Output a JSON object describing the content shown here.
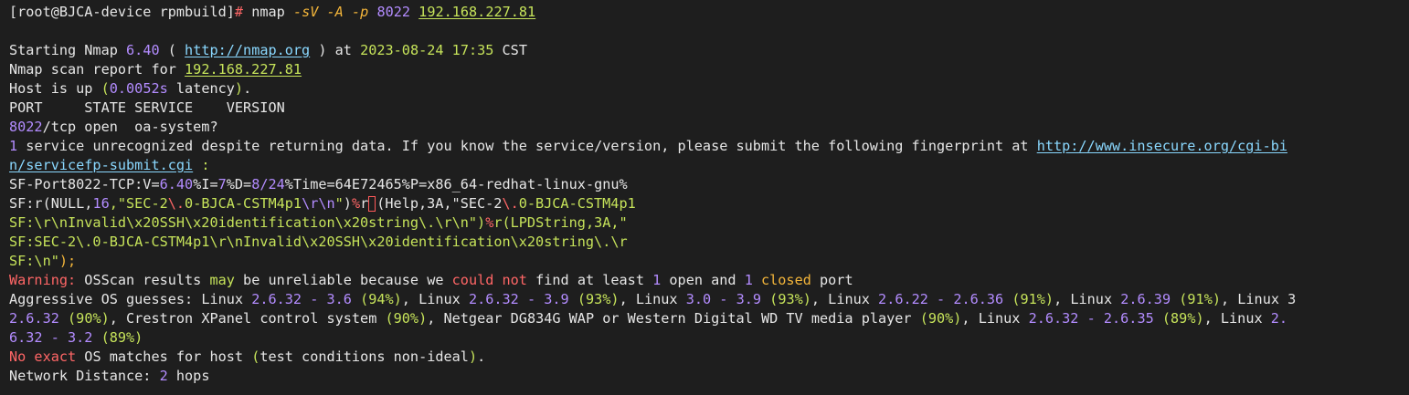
{
  "top_fragment": "        '",
  "prompt": {
    "user_host_dir": "[root@BJCA-device rpmbuild]",
    "hash": "#",
    "command": "nmap",
    "arg1": "-sV",
    "arg2": "-A",
    "arg3": "-p",
    "port": "8022",
    "target": "192.168.227.81"
  },
  "starting": {
    "prefix": "Starting Nmap",
    "version": "6.40",
    "open_paren": " ( ",
    "url": "http://nmap.org",
    "close_paren": " ) at ",
    "date": "2023-08-24",
    "time": "17:35",
    "tz": " CST"
  },
  "scan_report": {
    "prefix": "Nmap scan report for ",
    "ip": "192.168.227.81"
  },
  "host_up": {
    "prefix": "Host is up ",
    "latency": "(0.0052s latency).",
    "rest": ""
  },
  "table_header": "PORT     STATE SERVICE    VERSION",
  "port_line": {
    "port": "8022",
    "rest": "/tcp open  oa-system?"
  },
  "service_unrec": {
    "count": "1",
    "text": " service unrecognized despite returning data. If you know the service/version, please submit the following fingerprint at ",
    "url1": "http://www.insecure.org/cgi-bi",
    "url2": "n/servicefp-submit.cgi",
    "tail": " :"
  },
  "fingerprint": {
    "line1_a": "SF-Port8022-TCP:V=",
    "line1_b": "6.40",
    "line1_c": "%I=",
    "line1_d": "7",
    "line1_e": "%D=",
    "line1_f": "8/24",
    "line1_g": "%Time=64E72465%P=x86_64-redhat-linux-gnu%",
    "line2_a": "SF:r(NULL,",
    "line2_b": "16",
    "line2_c": ",\"SEC-2",
    "line2_d": "\\.",
    "line2_e": "0-BJCA-CSTM4p1",
    "line2_f": "\\r\\n",
    "line2_g": "\")",
    "line2_h": "%",
    "line2_i": "r",
    "line2_j": "(Help,3A,\"SEC-2",
    "line2_k": "\\.",
    "line2_l": "0-BJCA-CSTM4p1",
    "line3_a": "SF:\\r\\nInvalid\\x20SSH\\x20identification\\x20string\\.\\r\\n\")",
    "line3_b": "%",
    "line3_c": "r(LPDString,3A,\"",
    "line4": "SF:SEC-2\\.0-BJCA-CSTM4p1\\r\\nInvalid\\x20SSH\\x20identification\\x20string\\.\\r",
    "line5_a": "SF:\\n\"",
    "line5_b": ");"
  },
  "warning": {
    "w1": "Warning:",
    "w2": " OSScan results ",
    "w3": "may",
    "w4": " be unreliable because we ",
    "w5": "could not",
    "w6": " find at least ",
    "w7": "1",
    "w8": " open and ",
    "w9": "1",
    "w10": " closed",
    "w11": " port"
  },
  "guesses": {
    "label": "Aggressive OS guesses: ",
    "line1": [
      {
        "t": "Linux ",
        "c": "w"
      },
      {
        "t": "2.6.32 - 3.6",
        "c": "p"
      },
      {
        "t": " ",
        "c": "w"
      },
      {
        "t": "(94%)",
        "c": "g"
      },
      {
        "t": ", Linux ",
        "c": "w"
      },
      {
        "t": "2.6.32 - 3.9",
        "c": "p"
      },
      {
        "t": " ",
        "c": "w"
      },
      {
        "t": "(93%)",
        "c": "g"
      },
      {
        "t": ", Linux ",
        "c": "w"
      },
      {
        "t": "3.0 - 3.9",
        "c": "p"
      },
      {
        "t": " ",
        "c": "w"
      },
      {
        "t": "(93%)",
        "c": "g"
      },
      {
        "t": ", Linux ",
        "c": "w"
      },
      {
        "t": "2.6.22 - 2.6.36",
        "c": "p"
      },
      {
        "t": " ",
        "c": "w"
      },
      {
        "t": "(91%)",
        "c": "g"
      },
      {
        "t": ", Linux ",
        "c": "w"
      },
      {
        "t": "2.6.39",
        "c": "p"
      },
      {
        "t": " ",
        "c": "w"
      },
      {
        "t": "(91%)",
        "c": "g"
      },
      {
        "t": ", Linux 3",
        "c": "w"
      }
    ],
    "line2": [
      {
        "t": "2.6.32",
        "c": "p"
      },
      {
        "t": " ",
        "c": "w"
      },
      {
        "t": "(90%)",
        "c": "g"
      },
      {
        "t": ", Crestron XPanel control system ",
        "c": "w"
      },
      {
        "t": "(90%)",
        "c": "g"
      },
      {
        "t": ", Netgear DG834G WAP or Western Digital WD TV media player ",
        "c": "w"
      },
      {
        "t": "(90%)",
        "c": "g"
      },
      {
        "t": ", Linux ",
        "c": "w"
      },
      {
        "t": "2.6.32 - 2.6.35",
        "c": "p"
      },
      {
        "t": " ",
        "c": "w"
      },
      {
        "t": "(89%)",
        "c": "g"
      },
      {
        "t": ", Linux ",
        "c": "w"
      },
      {
        "t": "2.",
        "c": "p"
      }
    ],
    "line3": [
      {
        "t": "6.32 - 3.2",
        "c": "p"
      },
      {
        "t": " ",
        "c": "w"
      },
      {
        "t": "(89%)",
        "c": "g"
      }
    ]
  },
  "no_exact": {
    "red": "No exact",
    "rest": " OS matches for host ",
    "paren": "(test conditions non-ideal).",
    "tail": ""
  },
  "distance": {
    "label": "Network Distance: ",
    "num": "2",
    "unit": " hops"
  }
}
